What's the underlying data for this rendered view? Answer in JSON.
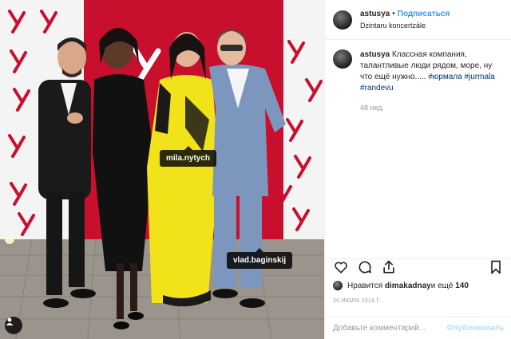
{
  "post": {
    "username": "astusya",
    "separator": "•",
    "follow_label": "Подписаться",
    "location": "Dzintaru koncertzāle"
  },
  "photo": {
    "tags": [
      "mila.nytych",
      "vlad.baginskij"
    ],
    "backdrop_color": "#c8102e"
  },
  "caption": {
    "username": "astusya",
    "text": "Классная компания, талантливые люди рядом, море, ну что ещё нужно..... ",
    "hashtags": [
      "#юрмала",
      "#jurmala",
      "#randevu"
    ],
    "time_ago": "48 нед."
  },
  "actions": {
    "icons": [
      "heart-icon",
      "comment-icon",
      "share-icon",
      "bookmark-icon"
    ]
  },
  "likes": {
    "prefix": "Нравится ",
    "user": "dimakadnay",
    "middle": " и ещё ",
    "count": "140"
  },
  "date": "20 ИЮЛЯ 2018 Г.",
  "comment": {
    "placeholder": "Добавьте комментарий...",
    "publish_label": "Опубликовать"
  }
}
